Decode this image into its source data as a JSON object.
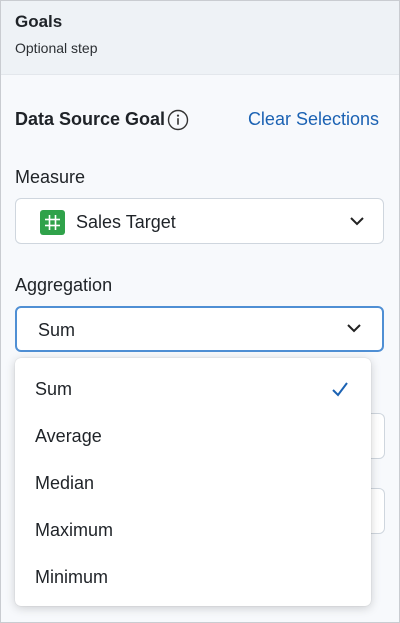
{
  "header": {
    "title": "Goals",
    "subtitle": "Optional step"
  },
  "section": {
    "title": "Data Source Goal",
    "clear_label": "Clear Selections"
  },
  "measure": {
    "label": "Measure",
    "value": "Sales Target",
    "icon": "number-grid-icon",
    "icon_color": "#2fa24a"
  },
  "aggregation": {
    "label": "Aggregation",
    "value": "Sum",
    "options": [
      "Sum",
      "Average",
      "Median",
      "Maximum",
      "Minimum"
    ],
    "selected": "Sum"
  },
  "colors": {
    "accent": "#1b62b3",
    "focus_border": "#4f8fd4"
  }
}
